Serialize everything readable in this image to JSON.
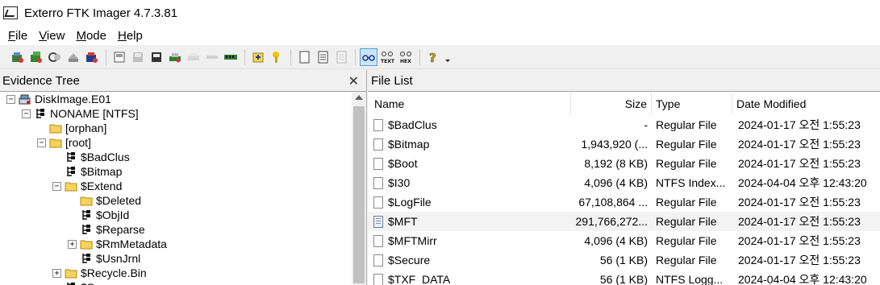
{
  "window": {
    "title": "Exterro FTK Imager 4.7.3.81"
  },
  "menu": [
    {
      "label_u": "F",
      "label_rest": "ile"
    },
    {
      "label_u": "V",
      "label_rest": "iew"
    },
    {
      "label_u": "M",
      "label_rest": "ode"
    },
    {
      "label_u": "H",
      "label_rest": "elp"
    }
  ],
  "toolbar": {
    "buttons": [
      "add-evidence-icon",
      "add-all-evidence-icon",
      "image-mounting-icon",
      "remove-evidence-icon",
      "remove-all-evidence-icon",
      "create-disk-image-icon",
      "export-disk-image-icon",
      "export-logical-image-icon",
      "capture-memory-icon",
      "obtain-protected-files-icon",
      "detect-encryption-icon",
      "ram-icon",
      "export-files-icon",
      "export-hash-icon",
      "new-document-icon",
      "view-text-icon",
      "view-hex-icon",
      "auto-view-icon",
      "text-view-icon",
      "hex-view-icon",
      "help-icon",
      "dropdown-icon"
    ]
  },
  "evidence_tree": {
    "title": "Evidence Tree",
    "nodes": [
      {
        "label": "DiskImage.E01",
        "kind": "disk",
        "expander": "−"
      },
      {
        "label": "NONAME [NTFS]",
        "kind": "partition",
        "expander": "−"
      },
      {
        "label": "[orphan]",
        "kind": "folder",
        "expander": ""
      },
      {
        "label": "[root]",
        "kind": "folder-open",
        "expander": "−"
      },
      {
        "label": "$BadClus",
        "kind": "file",
        "expander": ""
      },
      {
        "label": "$Bitmap",
        "kind": "file",
        "expander": ""
      },
      {
        "label": "$Extend",
        "kind": "folder-open",
        "expander": "−"
      },
      {
        "label": "$Deleted",
        "kind": "folder",
        "expander": ""
      },
      {
        "label": "$ObjId",
        "kind": "file",
        "expander": ""
      },
      {
        "label": "$Reparse",
        "kind": "file",
        "expander": ""
      },
      {
        "label": "$RmMetadata",
        "kind": "folder",
        "expander": "+"
      },
      {
        "label": "$UsnJrnl",
        "kind": "file",
        "expander": ""
      },
      {
        "label": "$Recycle.Bin",
        "kind": "folder",
        "expander": "+"
      },
      {
        "label": "$Secure",
        "kind": "file",
        "expander": ""
      }
    ]
  },
  "file_list": {
    "title": "File List",
    "columns": [
      "Name",
      "Size",
      "Type",
      "Date Modified"
    ],
    "rows": [
      {
        "name": "$BadClus",
        "size": "-",
        "type": "Regular File",
        "date": "2024-01-17 오전 1:55:23",
        "icon": "file-icon",
        "selected": false
      },
      {
        "name": "$Bitmap",
        "size": "1,943,920 (...",
        "type": "Regular File",
        "date": "2024-01-17 오전 1:55:23",
        "icon": "file-icon",
        "selected": false
      },
      {
        "name": "$Boot",
        "size": "8,192 (8 KB)",
        "type": "Regular File",
        "date": "2024-01-17 오전 1:55:23",
        "icon": "file-icon",
        "selected": false
      },
      {
        "name": "$I30",
        "size": "4,096 (4 KB)",
        "type": "NTFS Index...",
        "date": "2024-04-04 오후 12:43:20",
        "icon": "file-icon",
        "selected": false
      },
      {
        "name": "$LogFile",
        "size": "67,108,864 ...",
        "type": "Regular File",
        "date": "2024-01-17 오전 1:55:23",
        "icon": "file-icon",
        "selected": false
      },
      {
        "name": "$MFT",
        "size": "291,766,272...",
        "type": "Regular File",
        "date": "2024-01-17 오전 1:55:23",
        "icon": "mft-file-icon",
        "selected": true
      },
      {
        "name": "$MFTMirr",
        "size": "4,096 (4 KB)",
        "type": "Regular File",
        "date": "2024-01-17 오전 1:55:23",
        "icon": "file-icon",
        "selected": false
      },
      {
        "name": "$Secure",
        "size": "56 (1 KB)",
        "type": "Regular File",
        "date": "2024-01-17 오전 1:55:23",
        "icon": "file-icon",
        "selected": false
      },
      {
        "name": "$TXF_DATA",
        "size": "56 (1 KB)",
        "type": "NTFS Logg...",
        "date": "2024-04-04 오후 12:43:20",
        "icon": "file-icon",
        "selected": false
      }
    ]
  }
}
